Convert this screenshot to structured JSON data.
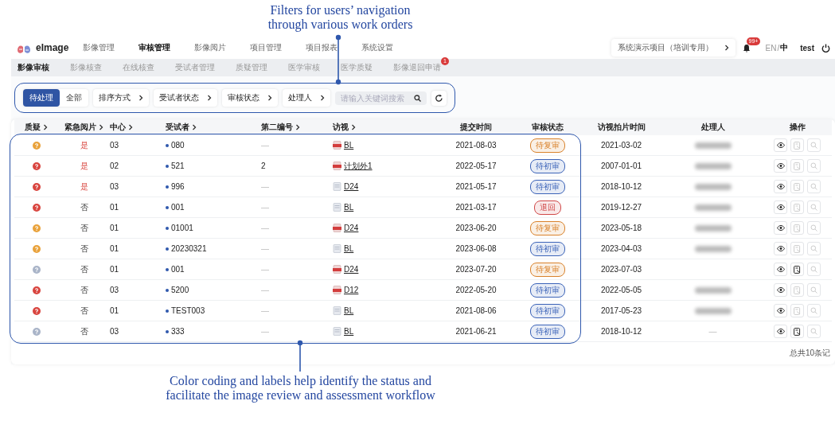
{
  "caption_top": "Filters for users’ navigation through various work orders",
  "app": {
    "logo": "eImage",
    "nav": [
      {
        "label": "影像管理",
        "selected": false
      },
      {
        "label": "审核管理",
        "selected": true
      },
      {
        "label": "影像阅片",
        "selected": false
      },
      {
        "label": "项目管理",
        "selected": false
      },
      {
        "label": "项目报表",
        "selected": false
      },
      {
        "label": "系统设置",
        "selected": false
      }
    ],
    "project": "系统演示项目（培训专用）",
    "notifications": "99+",
    "languages": [
      {
        "label": "EN",
        "selected": false
      },
      {
        "label": "中",
        "selected": true
      }
    ],
    "language_separator": "/",
    "user": "test",
    "subnav": [
      {
        "label": "影像审核",
        "selected": true
      },
      {
        "label": "影像核查",
        "selected": false
      },
      {
        "label": "在线核查",
        "selected": false
      },
      {
        "label": "受试者管理",
        "selected": false
      },
      {
        "label": "质疑管理",
        "selected": false
      },
      {
        "label": "医学审核",
        "selected": false
      },
      {
        "label": "医学质疑",
        "selected": false
      },
      {
        "label": "影像退回申请",
        "selected": false,
        "badge": "1"
      }
    ],
    "filters": {
      "segments": [
        {
          "label": "待处理",
          "selected": true
        },
        {
          "label": "全部",
          "selected": false
        }
      ],
      "dropdowns": [
        "排序方式",
        "受试者状态",
        "审核状态",
        "处理人"
      ],
      "search": {
        "placeholder": "请输入关键词搜索"
      }
    },
    "table": {
      "columns": [
        {
          "label": "质疑",
          "sortable": true
        },
        {
          "label": "紧急阅片",
          "sortable": true
        },
        {
          "label": "中心",
          "sortable": true
        },
        {
          "label": "受试者",
          "sortable": true
        },
        {
          "label": "第二编号",
          "sortable": true
        },
        {
          "label": "访视",
          "sortable": true
        },
        {
          "label": "提交时间",
          "sortable": false
        },
        {
          "label": "审核状态",
          "sortable": false
        },
        {
          "label": "访视拍片时间",
          "sortable": false
        },
        {
          "label": "处理人",
          "sortable": false
        },
        {
          "label": "操作",
          "sortable": false
        }
      ],
      "rows": [
        {
          "query": {
            "color": "#e9a23b"
          },
          "urgent": {
            "text": "是",
            "on": true
          },
          "center": "03",
          "subject": "080",
          "second_id": "—",
          "visit": {
            "kind": "pdf",
            "label": "BL"
          },
          "submitted": "2021-08-03",
          "status": {
            "label": "待复审",
            "color": "#d9822b"
          },
          "scan_date": "2021-03-02",
          "handler_redacted": true,
          "edit_enabled": false
        },
        {
          "query": {
            "color": "#d9453f"
          },
          "urgent": {
            "text": "是",
            "on": true
          },
          "center": "02",
          "subject": "521",
          "second_id": "2",
          "visit": {
            "kind": "pdf",
            "label": "计划外1"
          },
          "submitted": "2022-05-17",
          "status": {
            "label": "待初审",
            "color": "#3b63b8"
          },
          "scan_date": "2007-01-01",
          "handler_redacted": true,
          "edit_enabled": false
        },
        {
          "query": {
            "color": "#d9453f"
          },
          "urgent": {
            "text": "是",
            "on": true
          },
          "center": "03",
          "subject": "996",
          "second_id": "—",
          "visit": {
            "kind": "doc",
            "label": "D24"
          },
          "submitted": "2021-05-17",
          "status": {
            "label": "待初审",
            "color": "#3b63b8"
          },
          "scan_date": "2018-10-12",
          "handler_redacted": true,
          "edit_enabled": false
        },
        {
          "query": {
            "color": "#d9453f"
          },
          "urgent": {
            "text": "否",
            "on": false
          },
          "center": "01",
          "subject": "001",
          "second_id": "—",
          "visit": {
            "kind": "doc",
            "label": "BL"
          },
          "submitted": "2021-03-17",
          "status": {
            "label": "退回",
            "color": "#d04848"
          },
          "scan_date": "2019-12-27",
          "handler_redacted": true,
          "edit_enabled": false
        },
        {
          "query": {
            "color": "#e9a23b"
          },
          "urgent": {
            "text": "否",
            "on": false
          },
          "center": "01",
          "subject": "01001",
          "second_id": "—",
          "visit": {
            "kind": "pdf",
            "label": "D24"
          },
          "submitted": "2023-06-20",
          "status": {
            "label": "待复审",
            "color": "#d9822b"
          },
          "scan_date": "2023-05-18",
          "handler_redacted": true,
          "edit_enabled": false
        },
        {
          "query": {
            "color": "#e9a23b"
          },
          "urgent": {
            "text": "否",
            "on": false
          },
          "center": "01",
          "subject": "20230321",
          "second_id": "—",
          "visit": {
            "kind": "doc",
            "label": "BL"
          },
          "submitted": "2023-06-08",
          "status": {
            "label": "待初审",
            "color": "#3b63b8"
          },
          "scan_date": "2023-04-03",
          "handler_redacted": true,
          "edit_enabled": false
        },
        {
          "query": {
            "color": "#a9b4c8"
          },
          "urgent": {
            "text": "否",
            "on": false
          },
          "center": "01",
          "subject": "001",
          "second_id": "—",
          "visit": {
            "kind": "pdf",
            "label": "D24"
          },
          "submitted": "2023-07-20",
          "status": {
            "label": "待复审",
            "color": "#d9822b"
          },
          "scan_date": "2023-07-03",
          "handler_redacted": false,
          "edit_enabled": true
        },
        {
          "query": {
            "color": "#d9453f"
          },
          "urgent": {
            "text": "否",
            "on": false
          },
          "center": "03",
          "subject": "5200",
          "second_id": "—",
          "visit": {
            "kind": "pdf",
            "label": "D12"
          },
          "submitted": "2022-05-20",
          "status": {
            "label": "待初审",
            "color": "#3b63b8"
          },
          "scan_date": "2022-05-05",
          "handler_redacted": true,
          "edit_enabled": false
        },
        {
          "query": {
            "color": "#d9453f"
          },
          "urgent": {
            "text": "否",
            "on": false
          },
          "center": "01",
          "subject": "TEST003",
          "second_id": "—",
          "visit": {
            "kind": "doc",
            "label": "BL"
          },
          "submitted": "2021-08-06",
          "status": {
            "label": "待初审",
            "color": "#3b63b8"
          },
          "scan_date": "2017-05-23",
          "handler_redacted": true,
          "edit_enabled": false
        },
        {
          "query": {
            "color": "#a9b4c8"
          },
          "urgent": {
            "text": "否",
            "on": false
          },
          "center": "03",
          "subject": "333",
          "second_id": "—",
          "visit": {
            "kind": "doc",
            "label": "BL"
          },
          "submitted": "2021-06-21",
          "status": {
            "label": "待初审",
            "color": "#3b63b8"
          },
          "scan_date": "2018-10-12",
          "handler": "—",
          "handler_redacted": false,
          "edit_enabled": true
        }
      ]
    },
    "footer": "总共10条记"
  },
  "caption_bottom": "Color coding and labels help identify the status and facilitate the image review and assessment workflow"
}
